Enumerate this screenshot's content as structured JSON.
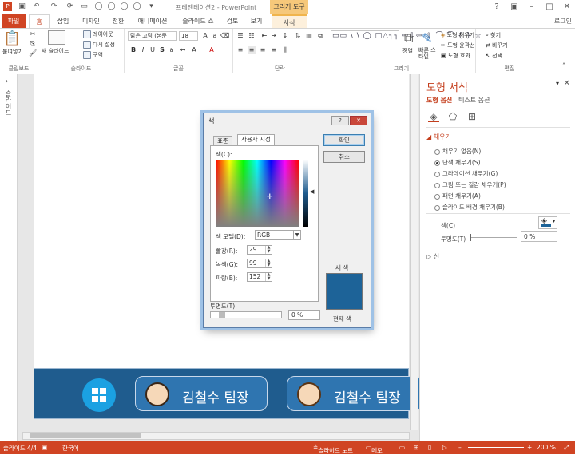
{
  "app": {
    "title": "프레젠테이션2 - PowerPoint",
    "context_tool": "그리기 도구",
    "login": "로그인"
  },
  "tabs": [
    "파일",
    "홈",
    "삽입",
    "디자인",
    "전환",
    "애니메이션",
    "슬라이드 쇼",
    "검토",
    "보기",
    "서식"
  ],
  "ribbon": {
    "groups": [
      "클립보드",
      "슬라이드",
      "글꼴",
      "단락",
      "그리기",
      "편집"
    ],
    "paste": "붙여넣기",
    "new_slide": "새 슬라이드",
    "layout": "레이아웃",
    "reset": "다시 설정",
    "section": "구역",
    "font_name": "맑은 고딕 (본문",
    "font_size": "18",
    "arrange": "정렬",
    "quick_styles": "빠른 스타일",
    "shape_fill": "도형 채우기",
    "shape_outline": "도형 윤곽선",
    "shape_effects": "도형 효과",
    "find": "찾기",
    "replace": "바꾸기",
    "select": "선택"
  },
  "left_pane": {
    "label": "슬라이드"
  },
  "slide": {
    "cards": [
      {
        "name": "김철수 팀장"
      },
      {
        "name": "김철수 팀장"
      }
    ]
  },
  "dialog": {
    "title": "색",
    "tab_standard": "표준",
    "tab_custom": "사용자 지정",
    "colors_label": "색(C):",
    "model_label": "색 모델(D):",
    "model_value": "RGB",
    "red_label": "빨강(R):",
    "green_label": "녹색(G):",
    "blue_label": "파랑(B):",
    "red": "29",
    "green": "99",
    "blue": "152",
    "ok": "확인",
    "cancel": "취소",
    "new_label": "새 색",
    "current_label": "현재 색",
    "transparency_label": "투명도(T):",
    "transparency_value": "0 %",
    "new_color": "#1d6398"
  },
  "format_pane": {
    "title": "도형 서식",
    "tab_shape": "도형 옵션",
    "tab_text": "텍스트 옵션",
    "fill_section": "채우기",
    "fill_options": [
      {
        "label": "채우기 없음(N)",
        "selected": false
      },
      {
        "label": "단색 채우기(S)",
        "selected": true
      },
      {
        "label": "그라데이션 채우기(G)",
        "selected": false
      },
      {
        "label": "그림 또는 질감 채우기(P)",
        "selected": false
      },
      {
        "label": "패턴 채우기(A)",
        "selected": false
      },
      {
        "label": "슬라이드 배경 채우기(B)",
        "selected": false
      }
    ],
    "color_label": "색(C)",
    "transparency_label": "투명도(T)",
    "transparency_value": "0 %",
    "line_section": "선"
  },
  "status": {
    "slide": "슬라이드 4/4",
    "language": "한국어",
    "notes": "슬라이드 노트",
    "memo": "메모",
    "zoom": "200 %"
  },
  "colors": {
    "accent": "#d04423",
    "banner": "#1f5c8e",
    "fill_color": "#1d6398"
  }
}
